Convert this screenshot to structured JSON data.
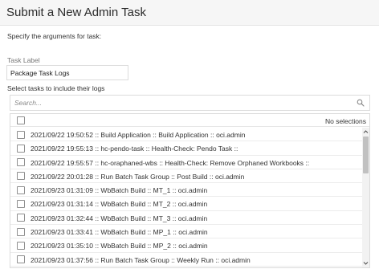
{
  "dialog": {
    "title": "Submit a New Admin Task",
    "instructions": "Specify the arguments for task:",
    "task_label": {
      "label": "Task Label",
      "value": "Package Task Logs"
    },
    "select_label": "Select tasks to include their logs",
    "search": {
      "placeholder": "Search..."
    },
    "list": {
      "selection_status": "No selections",
      "rows": [
        "2021/09/22 19:50:52 :: Build Application :: Build Application :: oci.admin",
        "2021/09/22 19:55:13 :: hc-pendo-task :: Health-Check: Pendo Task ::",
        "2021/09/22 19:55:57 :: hc-oraphaned-wbs :: Health-Check: Remove Orphaned Workbooks ::",
        "2021/09/22 20:01:28 :: Run Batch Task Group :: Post Build :: oci.admin",
        "2021/09/23 01:31:09 :: WbBatch Build :: MT_1 :: oci.admin",
        "2021/09/23 01:31:14 :: WbBatch Build :: MT_2 :: oci.admin",
        "2021/09/23 01:32:44 :: WbBatch Build :: MT_3 :: oci.admin",
        "2021/09/23 01:33:41 :: WbBatch Build :: MP_1 :: oci.admin",
        "2021/09/23 01:35:10 :: WbBatch Build :: MP_2 :: oci.admin",
        "2021/09/23 01:37:56 :: Run Batch Task Group :: Weekly Run :: oci.admin"
      ]
    }
  },
  "icons": {
    "search": "search-icon",
    "scroll_up": "chevron-up-icon",
    "scroll_down": "chevron-down-icon"
  },
  "colors": {
    "header_bg": "#f6f6f6",
    "border": "#dcdcdc",
    "scroll_thumb": "#c1c1c1"
  }
}
